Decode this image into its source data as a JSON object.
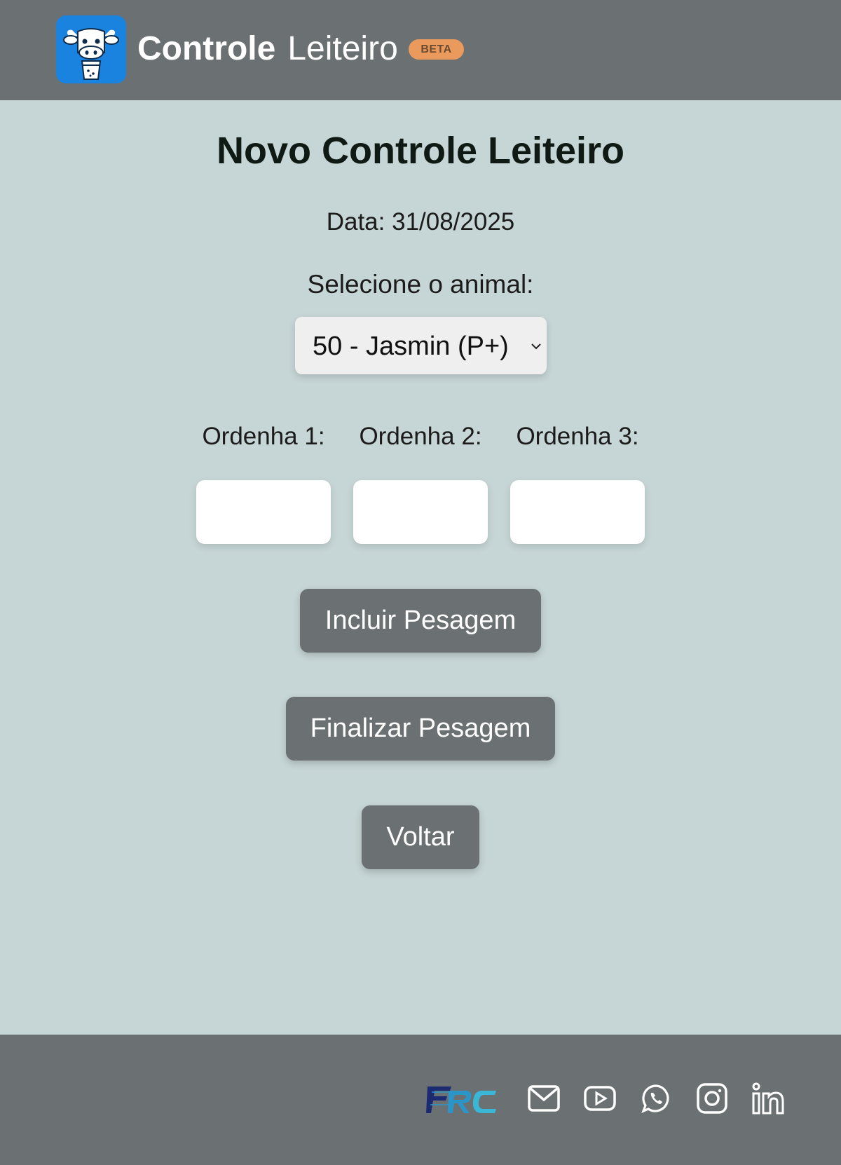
{
  "header": {
    "brand_bold": "Controle",
    "brand_light": "Leiteiro",
    "badge": "BETA",
    "logo_icon": "cow-milk-icon"
  },
  "main": {
    "title": "Novo Controle Leiteiro",
    "date_text": "Data: 31/08/2025",
    "select_label": "Selecione o animal:",
    "selected_animal": "50 - Jasmin (P+)",
    "ordenha_labels": [
      "Ordenha 1:",
      "Ordenha 2:",
      "Ordenha 3:"
    ],
    "ordenha_values": [
      "",
      "",
      ""
    ],
    "buttons": {
      "incluir": "Incluir Pesagem",
      "finalizar": "Finalizar Pesagem",
      "voltar": "Voltar"
    }
  },
  "footer": {
    "brand_logo": "FRC",
    "icons": [
      "mail-icon",
      "youtube-icon",
      "whatsapp-icon",
      "instagram-icon",
      "linkedin-icon"
    ]
  },
  "colors": {
    "header_bg": "#6b7073",
    "page_bg": "#c6d5d5",
    "logo_bg": "#1a82df",
    "badge_bg": "#ea9a5c",
    "button_bg": "#6b7073"
  }
}
